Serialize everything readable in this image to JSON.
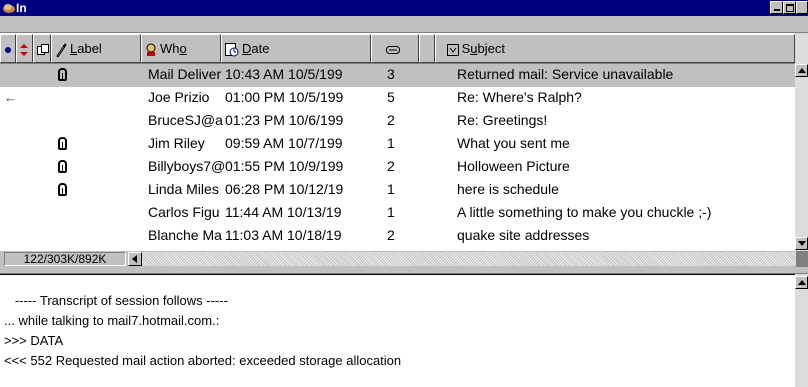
{
  "window": {
    "title": "In",
    "icon": "eudora-mailbox-icon",
    "controls": {
      "minimize": "minimize-icon",
      "maximize": "maximize-icon",
      "close": "close-icon"
    }
  },
  "columns": {
    "status": {
      "icon": "status-dot-icon"
    },
    "priority": {
      "icon": "priority-arrows-icon"
    },
    "attachment": {
      "icon": "attachment-icon"
    },
    "label": {
      "icon": "label-tag-icon",
      "text": "Label",
      "accel": "L",
      "rest": "abel"
    },
    "who": {
      "icon": "who-person-icon",
      "text": "Who",
      "pre": "Wh",
      "accel": "o"
    },
    "date": {
      "icon": "date-clock-icon",
      "text": "Date",
      "accel": "D",
      "rest": "ate"
    },
    "size": {
      "icon": "size-icon"
    },
    "server": {
      "icon": "server-status-icon"
    },
    "subject": {
      "icon": "subject-icon",
      "text": "Subject",
      "pre": "S",
      "accel": "u",
      "rest": "bject"
    }
  },
  "messages": [
    {
      "status": "",
      "attachment": true,
      "who": "Mail Deliver",
      "date": "10:43 AM 10/5/199",
      "size": "3",
      "subject": "Returned mail: Service unavailable",
      "selected": true
    },
    {
      "status": "←",
      "attachment": false,
      "who": "Joe Prizio",
      "date": "01:00 PM 10/5/199",
      "size": "5",
      "subject": "Re: Where's Ralph?",
      "selected": false
    },
    {
      "status": "",
      "attachment": false,
      "who": "BruceSJ@a",
      "date": "01:23 PM 10/6/199",
      "size": "2",
      "subject": "Re: Greetings!",
      "selected": false
    },
    {
      "status": "",
      "attachment": true,
      "who": "Jim Riley",
      "date": "09:59 AM 10/7/199",
      "size": "1",
      "subject": "What you sent me",
      "selected": false
    },
    {
      "status": "",
      "attachment": true,
      "who": "Billyboys7@",
      "date": "01:55 PM 10/9/199",
      "size": "2",
      "subject": "Holloween Picture",
      "selected": false
    },
    {
      "status": "",
      "attachment": true,
      "who": "Linda Miles",
      "date": "06:28 PM 10/12/19",
      "size": "1",
      "subject": "here is schedule",
      "selected": false
    },
    {
      "status": "",
      "attachment": false,
      "who": "Carlos Figu",
      "date": "11:44 AM 10/13/19",
      "size": "1",
      "subject": "A little something to make you chuckle ;-)",
      "selected": false
    },
    {
      "status": "",
      "attachment": false,
      "who": "Blanche Ma",
      "date": "11:03 AM 10/18/19",
      "size": "2",
      "subject": "quake site addresses",
      "selected": false
    }
  ],
  "status_bar": {
    "count": "122/303K/892K"
  },
  "preview": {
    "lines": [
      "   ----- Transcript of session follows -----",
      "... while talking to mail7.hotmail.com.:",
      ">>> DATA",
      "<<< 552 Requested mail action aborted: exceeded storage allocation"
    ]
  },
  "colors": {
    "titlebar": "#000080",
    "face": "#c0c0c0",
    "selected_row": "#c0c0c0"
  }
}
